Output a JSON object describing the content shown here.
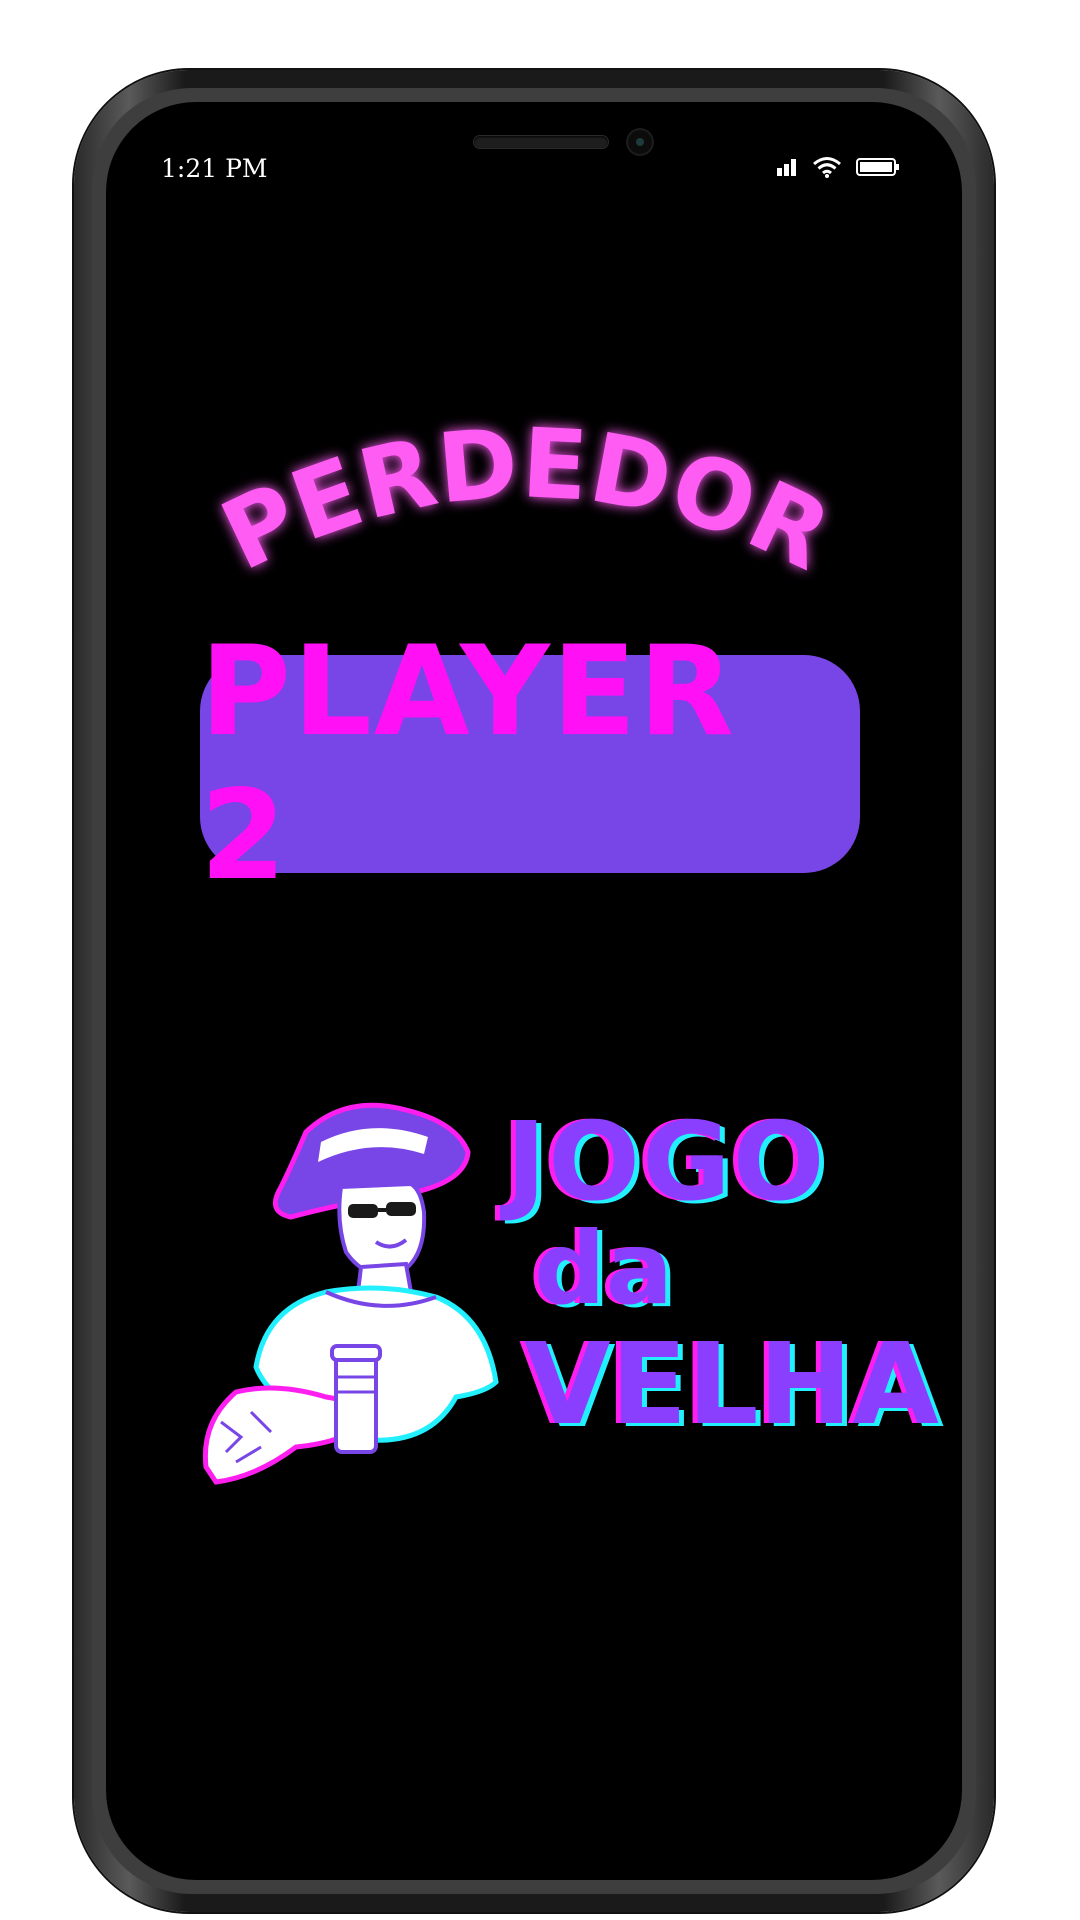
{
  "status_bar": {
    "time": "1:21 PM",
    "icons": [
      "signal-icon",
      "wifi-icon",
      "battery-icon"
    ]
  },
  "result": {
    "title": "PERDEDOR",
    "player": "PLAYER 2"
  },
  "logo": {
    "line1": "JOGO",
    "line2": "da",
    "line3": "VELHA"
  },
  "colors": {
    "background": "#000000",
    "title": "#ff5cf4",
    "player_box": "#7845e6",
    "player_text": "#ff10f5",
    "logo_main": "#8a3fff",
    "logo_magenta": "#ff1ef0",
    "logo_cyan": "#22f0ff"
  }
}
